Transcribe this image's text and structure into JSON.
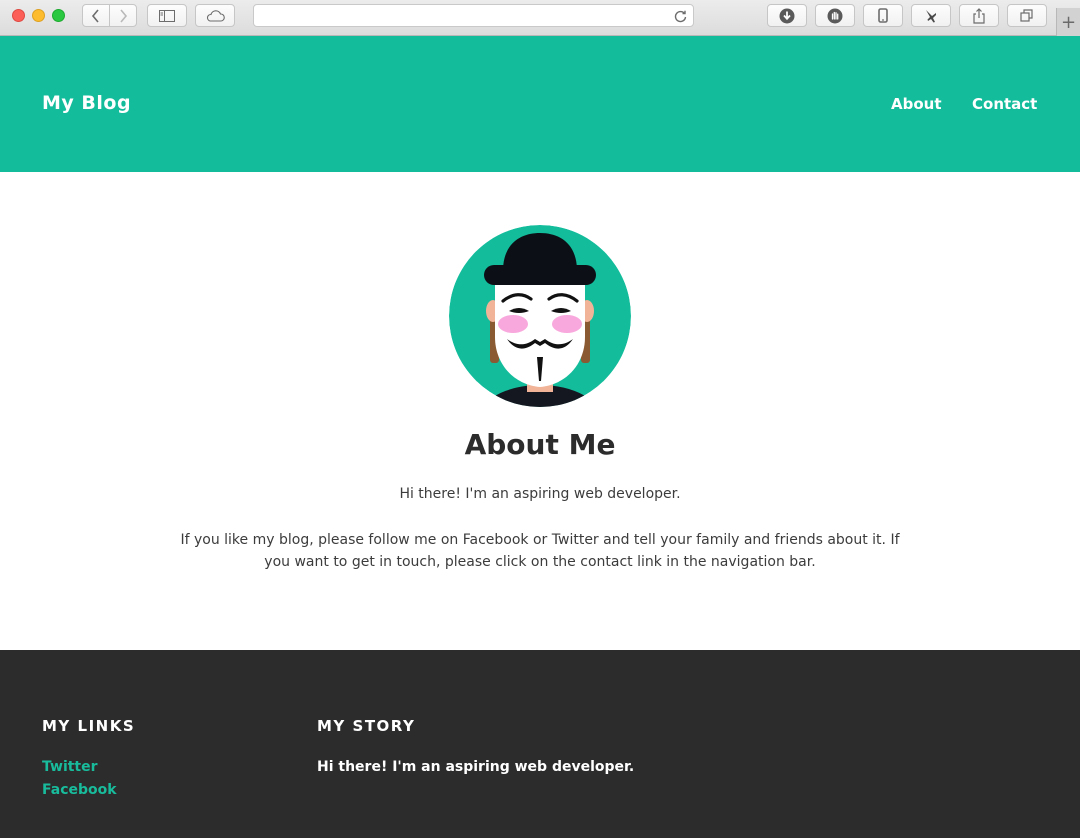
{
  "browser": {
    "address_value": "",
    "new_tab_symbol": "+"
  },
  "header": {
    "brand": "My Blog",
    "nav": [
      {
        "label": "About"
      },
      {
        "label": "Contact"
      }
    ],
    "color": "#13bd9c"
  },
  "main": {
    "avatar_icon": "masked-avatar-icon",
    "title": "About Me",
    "intro": "Hi there! I'm an aspiring web developer.",
    "followup": "If you like my blog, please follow me on Facebook or Twitter and tell your family and friends about it. If you want to get in touch, please click on the contact link in the navigation bar."
  },
  "footer": {
    "links_heading": "MY LINKS",
    "links": [
      {
        "label": "Twitter"
      },
      {
        "label": "Facebook"
      }
    ],
    "story_heading": "MY STORY",
    "story_text": "Hi there! I'm an aspiring web developer.",
    "color": "#2c2c2c",
    "link_color": "#18bc9c"
  }
}
